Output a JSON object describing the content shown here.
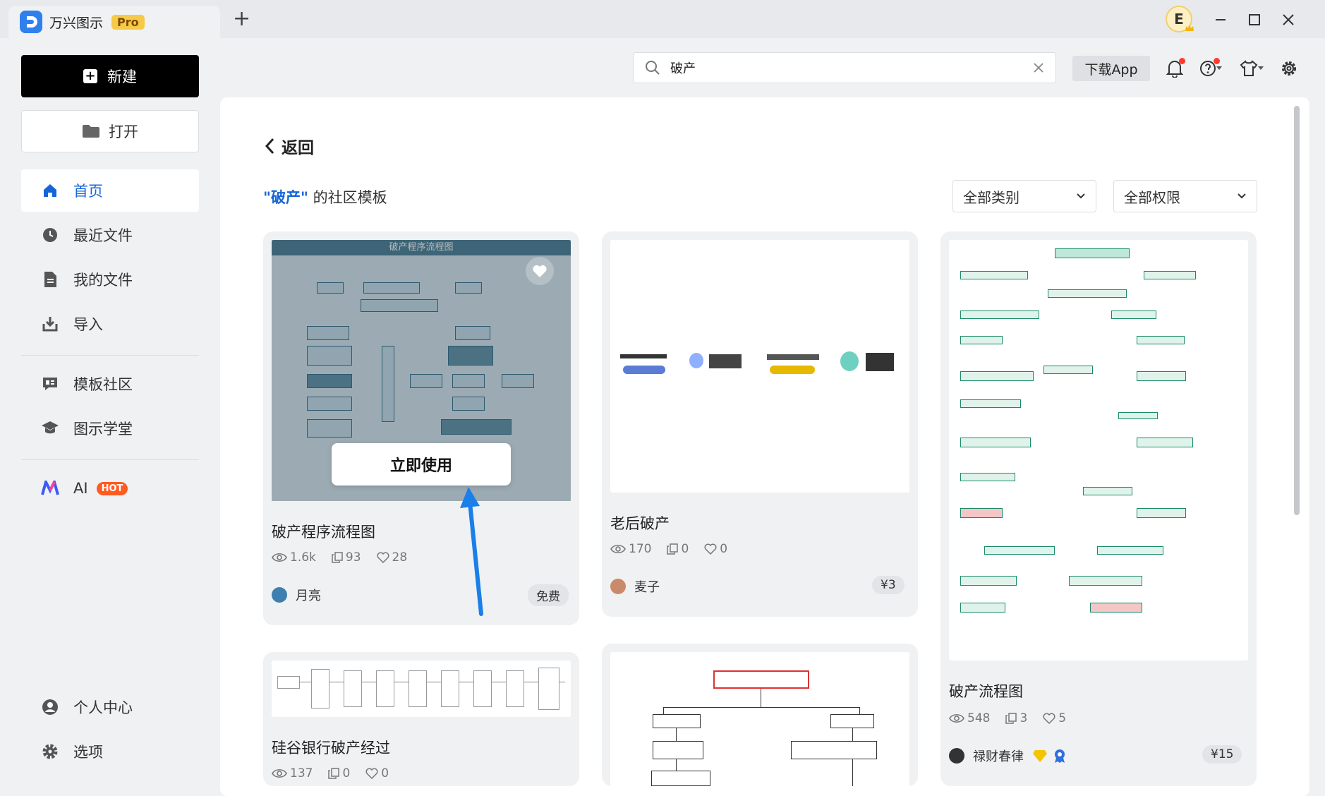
{
  "app": {
    "name": "万兴图示",
    "badge": "Pro",
    "user_initial": "E"
  },
  "sidebar": {
    "new_label": "新建",
    "open_label": "打开",
    "items": [
      {
        "label": "首页"
      },
      {
        "label": "最近文件"
      },
      {
        "label": "我的文件"
      },
      {
        "label": "导入"
      },
      {
        "label": "模板社区"
      },
      {
        "label": "图示学堂"
      },
      {
        "label": "AI",
        "badge": "HOT"
      }
    ],
    "bottom_items": [
      {
        "label": "个人中心"
      },
      {
        "label": "选项"
      }
    ]
  },
  "toolbar": {
    "search_value": "破产",
    "download_label": "下载App"
  },
  "main": {
    "back_label": "返回",
    "keyword": "\"破产\"",
    "section_suffix": "的社区模板",
    "filter_category": "全部类别",
    "filter_permission": "全部权限",
    "use_button": "立即使用"
  },
  "cards": [
    {
      "title": "破产程序流程图",
      "thumb_title": "破产程序流程图",
      "views": "1.6k",
      "copies": "93",
      "likes": "28",
      "author": "月亮",
      "price": "免费"
    },
    {
      "title": "老后破产",
      "views": "170",
      "copies": "0",
      "likes": "0",
      "author": "麦子",
      "price": "¥3"
    },
    {
      "title": "破产流程图",
      "views": "548",
      "copies": "3",
      "likes": "5",
      "author": "禄财春律",
      "price": "¥15"
    },
    {
      "title": "硅谷银行破产经过",
      "views": "137",
      "copies": "0",
      "likes": "0"
    },
    {
      "title": ""
    }
  ],
  "colors": {
    "accent": "#1565d8",
    "arrow": "#1a7fe8",
    "hot": "#ff5a1f",
    "pro": "#f7c948"
  }
}
